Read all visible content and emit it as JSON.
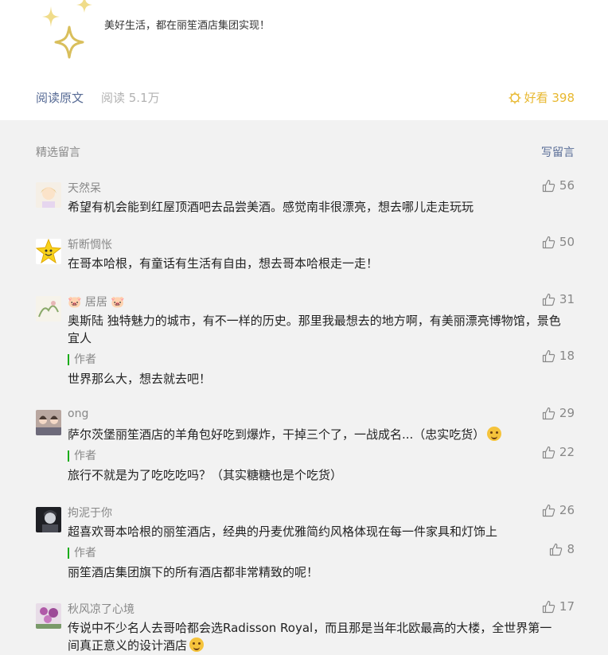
{
  "header": {
    "slogan": "美好生活，都在丽笙酒店集团实现！"
  },
  "readbar": {
    "read_original": "阅读原文",
    "read_count": "阅读 5.1万",
    "like_label": "好看 398",
    "like_color": "#e8b82f"
  },
  "comments_section": {
    "title": "精选留言",
    "write_label": "写留言",
    "items": [
      {
        "nickname": "天然呆",
        "text": "希望有机会能到红屋顶酒吧去品尝美酒。感觉南非很漂亮，想去哪儿走走玩玩",
        "likes": "56"
      },
      {
        "nickname": "斩断惆怅",
        "text": "在哥本哈根，有童话有生活有自由，想去哥本哈根走一走！",
        "likes": "50"
      },
      {
        "nickname": "居居",
        "text": "奥斯陆 独特魅力的城市，有不一样的历史。那里我最想去的地方啊，有美丽漂亮博物馆，景色宜人",
        "likes": "31",
        "reply": {
          "tag": "作者",
          "text": "世界那么大，想去就去吧！",
          "likes": "18"
        }
      },
      {
        "nickname": "ong",
        "text": "萨尔茨堡丽笙酒店的羊角包好吃到爆炸，干掉三个了，一战成名...（忠实吃货）",
        "likes": "29",
        "reply": {
          "tag": "作者",
          "text": "旅行不就是为了吃吃吃吗？（其实糖糖也是个吃货）",
          "likes": "22"
        }
      },
      {
        "nickname": "拘泥于你",
        "text": "超喜欢哥本哈根的丽笙酒店，经典的丹麦优雅简约风格体现在每一件家具和灯饰上",
        "likes": "26",
        "reply": {
          "tag": "作者",
          "text": "丽笙酒店集团旗下的所有酒店都非常精致的呢！",
          "likes": "8"
        }
      },
      {
        "nickname": "秋风凉了心境",
        "text": "传说中不少名人去哥哈都会选Radisson Royal，而且那是当年北欧最高的大楼，全世界第一间真正意义的设计酒店",
        "likes": "17"
      }
    ]
  },
  "icons": {
    "sparkle": "sparkle-icon",
    "like": "thumbs-up-icon",
    "wow": "wow-icon"
  }
}
